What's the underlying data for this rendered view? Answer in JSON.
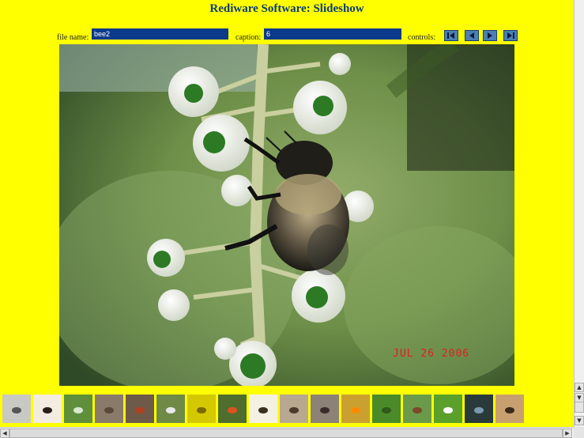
{
  "app": {
    "title": "Rediware Software: Slideshow"
  },
  "fields": {
    "file_name_label": "file name:",
    "file_name_value": "bee2",
    "caption_label": "caption:",
    "caption_value": "6",
    "controls_label": "controls:"
  },
  "controls": [
    {
      "name": "first-button",
      "icon": "skip-first-icon"
    },
    {
      "name": "previous-button",
      "icon": "play-back-icon"
    },
    {
      "name": "next-button",
      "icon": "play-forward-icon"
    },
    {
      "name": "last-button",
      "icon": "skip-last-icon"
    }
  ],
  "photo": {
    "date_stamp": "JUL 26 2006"
  },
  "thumbnails": [
    {
      "bg": "#c9c9c4",
      "accent": "#555"
    },
    {
      "bg": "#f3ece0",
      "accent": "#2a2018"
    },
    {
      "bg": "#5f8f3a",
      "accent": "#d9e7cf"
    },
    {
      "bg": "#8a7a6a",
      "accent": "#5a4a3a"
    },
    {
      "bg": "#6e5a48",
      "accent": "#b04020"
    },
    {
      "bg": "#6f8a46",
      "accent": "#e8e8e8"
    },
    {
      "bg": "#d4c800",
      "accent": "#7a6a00"
    },
    {
      "bg": "#4f6e2e",
      "accent": "#e05020"
    },
    {
      "bg": "#f4f0e2",
      "accent": "#3a3020"
    },
    {
      "bg": "#b9a890",
      "accent": "#4a3a2a"
    },
    {
      "bg": "#8c8276",
      "accent": "#3a2a2a"
    },
    {
      "bg": "#caa030",
      "accent": "#ff8a00"
    },
    {
      "bg": "#4a8a2a",
      "accent": "#2f5a1a"
    },
    {
      "bg": "#6a9a4a",
      "accent": "#7a4a2a"
    },
    {
      "bg": "#5aa02a",
      "accent": "#ffffff"
    },
    {
      "bg": "#2a3a3a",
      "accent": "#7a9ab0"
    },
    {
      "bg": "#c8a070",
      "accent": "#3a2a1a"
    }
  ]
}
